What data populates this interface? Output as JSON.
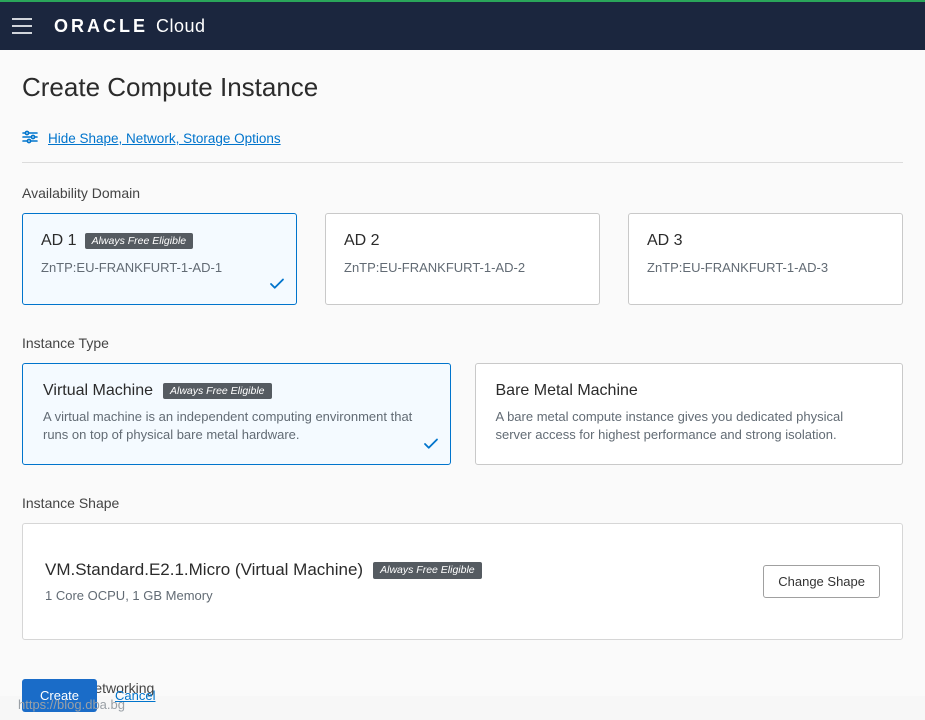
{
  "header": {
    "brand_strong": "ORACLE",
    "brand_light": "Cloud"
  },
  "page": {
    "title": "Create Compute Instance",
    "toggle_link": "Hide Shape, Network, Storage Options"
  },
  "availability": {
    "label": "Availability Domain",
    "badge_text": "Always Free Eligible",
    "domains": [
      {
        "title": "AD 1",
        "sub": "ZnTP:EU-FRANKFURT-1-AD-1",
        "selected": true,
        "free": true
      },
      {
        "title": "AD 2",
        "sub": "ZnTP:EU-FRANKFURT-1-AD-2",
        "selected": false,
        "free": false
      },
      {
        "title": "AD 3",
        "sub": "ZnTP:EU-FRANKFURT-1-AD-3",
        "selected": false,
        "free": false
      }
    ]
  },
  "instance_type": {
    "label": "Instance Type",
    "options": [
      {
        "title": "Virtual Machine",
        "free": true,
        "desc": "A virtual machine is an independent computing environment that runs on top of physical bare metal hardware.",
        "selected": true
      },
      {
        "title": "Bare Metal Machine",
        "free": false,
        "desc": "A bare metal compute instance gives you dedicated physical server access for highest performance and strong isolation.",
        "selected": false
      }
    ]
  },
  "shape": {
    "label": "Instance Shape",
    "title": "VM.Standard.E2.1.Micro (Virtual Machine)",
    "free": true,
    "sub": "1 Core OCPU, 1 GB Memory",
    "change_btn": "Change Shape"
  },
  "network": {
    "label": "Configure networking"
  },
  "footer": {
    "create": "Create",
    "cancel": "Cancel"
  },
  "watermark": "https://blog.dba.bg"
}
